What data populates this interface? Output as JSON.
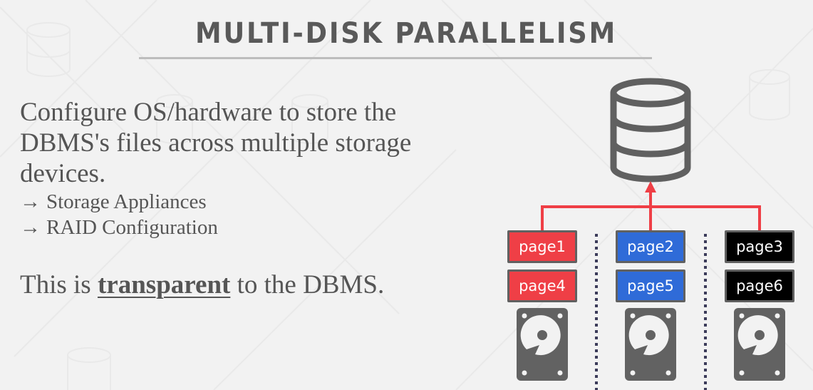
{
  "slide": {
    "title": "MULTI-DISK PARALLELISM",
    "body": {
      "paragraph": "Configure OS/hardware to store the DBMS's files across multiple storage devices.",
      "bullets": [
        {
          "arrow": "→",
          "text": "Storage Appliances"
        },
        {
          "arrow": "→",
          "text": "RAID Configuration"
        }
      ],
      "closing": {
        "prefix": "This is ",
        "emphasis": "transparent",
        "suffix": " to the DBMS."
      }
    },
    "diagram": {
      "database_icon": "database-icon",
      "disk_icon": "hard-drive-icon",
      "arrow_color": "#ef3f46",
      "columns": [
        {
          "pages": [
            "page1",
            "page4"
          ],
          "color": "#ef3f46"
        },
        {
          "pages": [
            "page2",
            "page5"
          ],
          "color": "#2f6bd8"
        },
        {
          "pages": [
            "page3",
            "page6"
          ],
          "color": "#000000"
        }
      ]
    }
  }
}
